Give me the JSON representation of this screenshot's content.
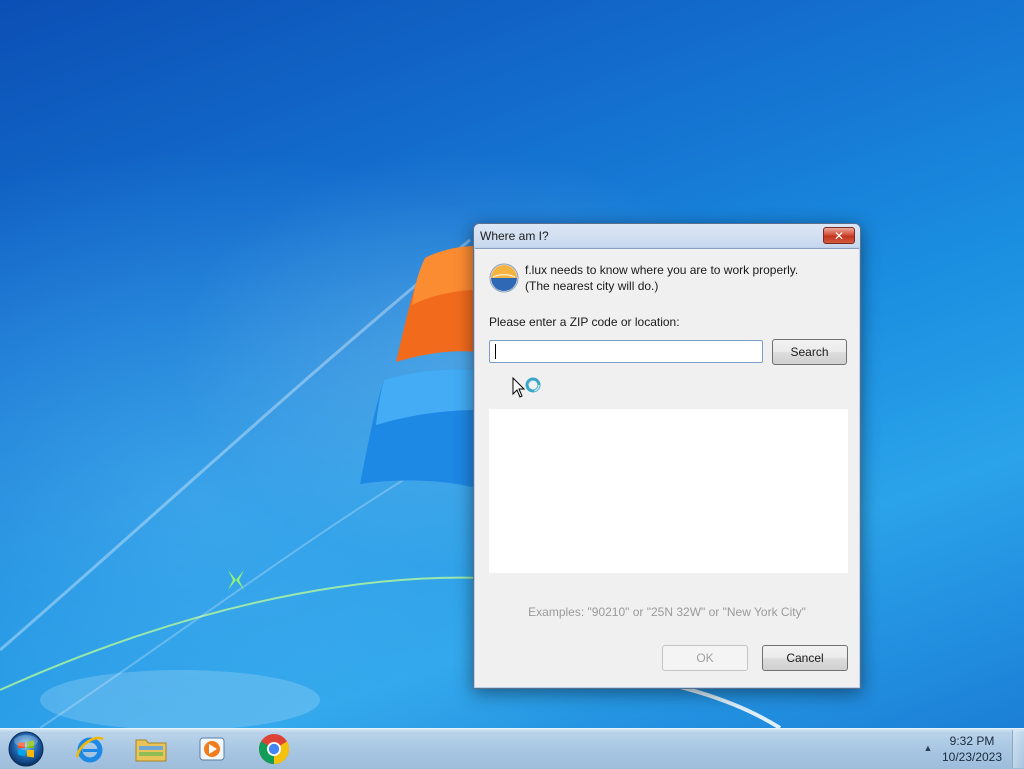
{
  "dialog": {
    "title": "Where am I?",
    "close_label": "✕",
    "intro_line1": "f.lux needs to know where you are to work properly.",
    "intro_line2": "(The nearest city will do.)",
    "prompt": "Please enter a ZIP code or location:",
    "location_value": "",
    "search_label": "Search",
    "examples": "Examples: \"90210\" or \"25N 32W\" or \"New York City\"",
    "ok_label": "OK",
    "cancel_label": "Cancel",
    "ok_enabled": false
  },
  "taskbar": {
    "pinned": [
      {
        "name": "Internet Explorer",
        "icon": "internet-explorer-icon"
      },
      {
        "name": "Windows Explorer",
        "icon": "folder-icon"
      },
      {
        "name": "Windows Media Player",
        "icon": "media-player-icon"
      },
      {
        "name": "Google Chrome",
        "icon": "chrome-icon"
      }
    ],
    "clock_time": "9:32 PM",
    "clock_date": "10/23/2023"
  },
  "colors": {
    "accent": "#1470cf",
    "close_button": "#c0361f"
  }
}
